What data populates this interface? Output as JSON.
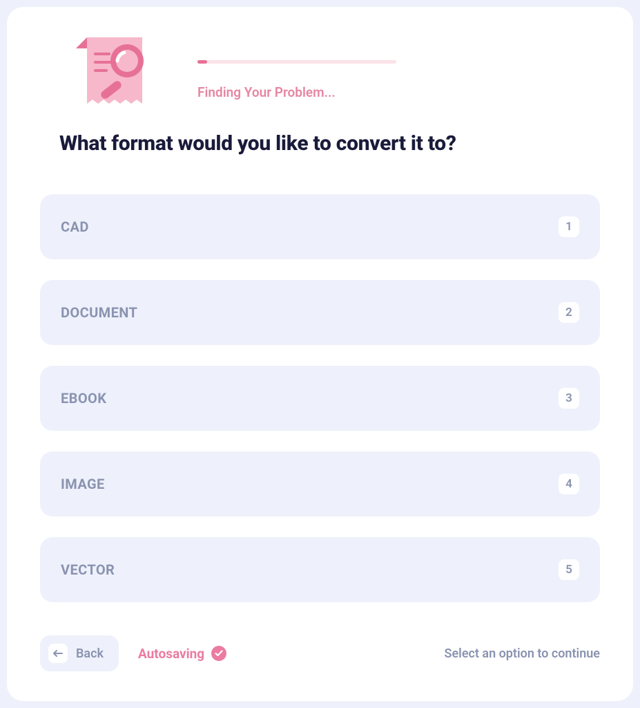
{
  "header": {
    "progress_label": "Finding Your Problem...",
    "progress_percent": 5
  },
  "question": "What format would you like to convert it to?",
  "options": [
    {
      "label": "CAD",
      "key": "1"
    },
    {
      "label": "DOCUMENT",
      "key": "2"
    },
    {
      "label": "EBOOK",
      "key": "3"
    },
    {
      "label": "IMAGE",
      "key": "4"
    },
    {
      "label": "VECTOR",
      "key": "5"
    }
  ],
  "footer": {
    "back_label": "Back",
    "autosave_label": "Autosaving",
    "hint": "Select an option to continue"
  }
}
